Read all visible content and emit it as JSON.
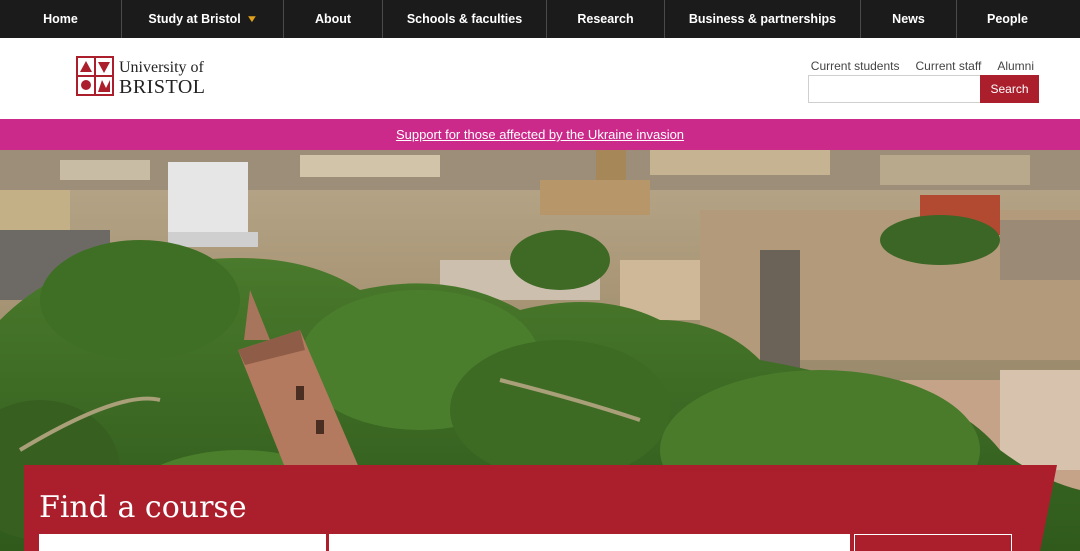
{
  "nav": {
    "items": [
      {
        "label": "Home"
      },
      {
        "label": "Study at Bristol",
        "has_dropdown": true
      },
      {
        "label": "About"
      },
      {
        "label": "Schools & faculties"
      },
      {
        "label": "Research"
      },
      {
        "label": "Business & partnerships"
      },
      {
        "label": "News"
      },
      {
        "label": "People"
      }
    ],
    "dropdown_icon": "chevron-down-icon",
    "dropdown_color": "#e0a11b"
  },
  "logo": {
    "line1": "University of",
    "line2": "BRISTOL",
    "crest_color": "#ab1f2d"
  },
  "utility_links": [
    "Current students",
    "Current staff",
    "Alumni"
  ],
  "search": {
    "value": "",
    "button_label": "Search"
  },
  "banner": {
    "link_text": "Support for those affected by the Ukraine invasion",
    "color": "#cc2a8a"
  },
  "course_finder": {
    "title": "Find a course",
    "panel_color": "#ab1f2d"
  },
  "colors": {
    "nav_bg": "#1b1b1b",
    "brand_red": "#ab1f2d"
  }
}
